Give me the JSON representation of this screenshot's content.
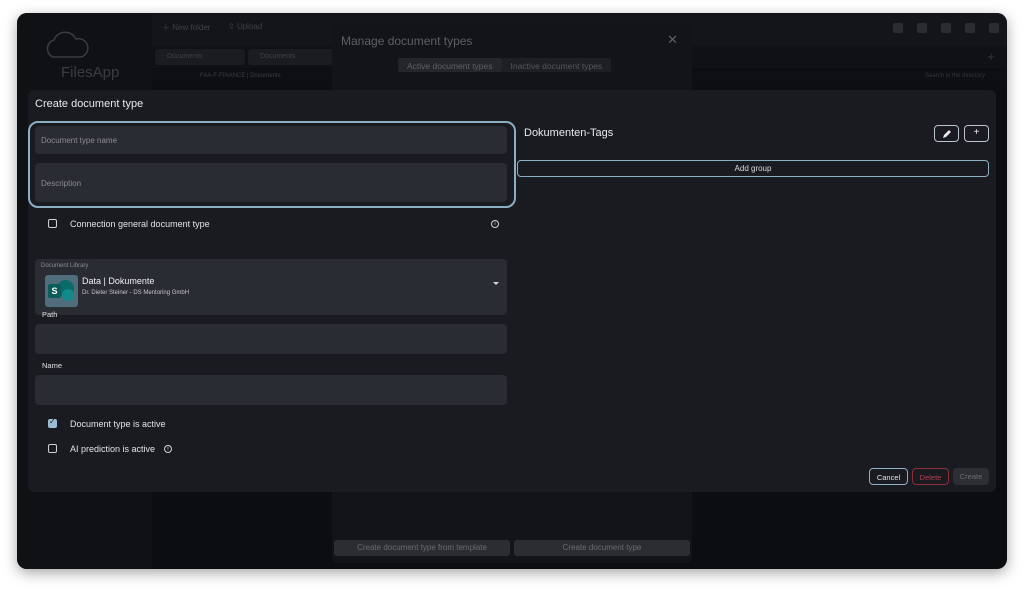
{
  "background": {
    "app_name": "FilesApp",
    "toolbar": {
      "new_folder": "New folder",
      "upload": "Upload"
    },
    "tabs": [
      "Documents",
      "Documents"
    ],
    "path": "FAA-F-FINANCE | Documents",
    "search_placeholder": "Search in the directory"
  },
  "manage_dialog": {
    "title": "Manage document types",
    "close": "✕",
    "tabs": {
      "active": "Active document types",
      "inactive": "Inactive document types"
    },
    "buttons": {
      "from_template": "Create document type from template",
      "create": "Create document type"
    }
  },
  "create_dialog": {
    "title": "Create document type",
    "fields": {
      "name_placeholder": "Document type name",
      "description_placeholder": "Description"
    },
    "connection_label": "Connection general document type",
    "library": {
      "label": "Document Library",
      "name": "Data | Dokumente",
      "subtitle": "Dr. Dieter Steiner - DS Mentoring GmbH",
      "icon": "sharepoint-icon"
    },
    "path_label": "Path",
    "name_label": "Name",
    "active_label": "Document type is active",
    "active_checked": true,
    "ai_label": "AI prediction is active",
    "ai_checked": false,
    "tags": {
      "title": "Dokumenten-Tags",
      "add_group": "Add group",
      "edit_icon": "pencil-icon",
      "add_icon": "plus-icon"
    },
    "buttons": {
      "cancel": "Cancel",
      "delete": "Delete",
      "create": "Create"
    },
    "colors": {
      "accent": "#8aaec4",
      "danger": "#b0404f",
      "surface": "#1a1b20",
      "field": "#2a2c33"
    }
  }
}
